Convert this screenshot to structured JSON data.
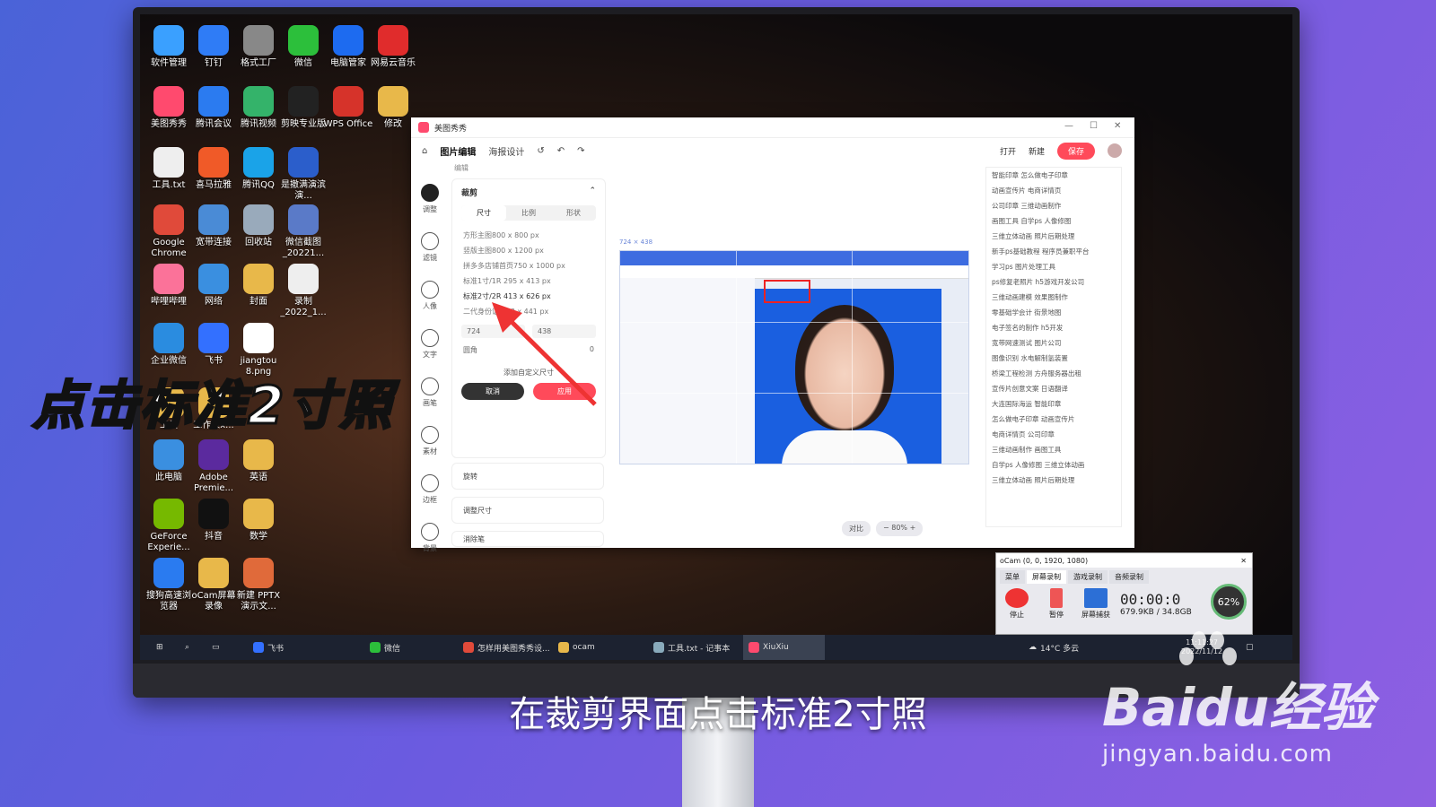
{
  "desktop_icons": [
    {
      "label": "软件管理",
      "color": "#3aa0ff"
    },
    {
      "label": "钉钉",
      "color": "#2f7cf6"
    },
    {
      "label": "格式工厂",
      "color": "#888"
    },
    {
      "label": "微信",
      "color": "#2cbf3b"
    },
    {
      "label": "电脑管家",
      "color": "#1d6bf0"
    },
    {
      "label": "网易云音乐",
      "color": "#e02c2c"
    },
    {
      "label": "美图秀秀",
      "color": "#ff4a6e"
    },
    {
      "label": "腾讯会议",
      "color": "#2b7bf0"
    },
    {
      "label": "腾讯视频",
      "color": "#34b36a"
    },
    {
      "label": "剪映专业版",
      "color": "#222"
    },
    {
      "label": "WPS Office",
      "color": "#d6332a"
    },
    {
      "label": "修改",
      "color": "#e8b84a"
    },
    {
      "label": "工具.txt",
      "color": "#eee"
    },
    {
      "label": "喜马拉雅",
      "color": "#f05a28"
    },
    {
      "label": "腾讯QQ",
      "color": "#1aa3e8"
    },
    {
      "label": "是撤满演滨演...",
      "color": "#2b5ecb"
    },
    {
      "label": "Google Chrome",
      "color": "#e04a3a"
    },
    {
      "label": "宽带连接",
      "color": "#4a8bd6"
    },
    {
      "label": "回收站",
      "color": "#9ab"
    },
    {
      "label": "微信截图_20221...",
      "color": "#5a7ac8"
    },
    {
      "label": "哔哩哔哩",
      "color": "#fb7299"
    },
    {
      "label": "网络",
      "color": "#3a8fe0"
    },
    {
      "label": "封面",
      "color": "#e8b84a"
    },
    {
      "label": "录制_2022_1...",
      "color": "#eee"
    },
    {
      "label": "企业微信",
      "color": "#2a8ce0"
    },
    {
      "label": "飞书",
      "color": "#3370ff"
    },
    {
      "label": "jiangtou 8.png",
      "color": "#fff"
    },
    {
      "label": "工具",
      "color": "#e8b84a"
    },
    {
      "label": "工作表x...",
      "color": "#e8b84a"
    },
    {
      "label": "此电脑",
      "color": "#3a8fe0"
    },
    {
      "label": "Adobe Premie...",
      "color": "#5b2a9e"
    },
    {
      "label": "英语",
      "color": "#e8b84a"
    },
    {
      "label": "GeForce Experie...",
      "color": "#76b900"
    },
    {
      "label": "抖音",
      "color": "#111"
    },
    {
      "label": "数学",
      "color": "#e8b84a"
    },
    {
      "label": "搜狗高速浏览器",
      "color": "#2a7bf0"
    },
    {
      "label": "oCam屏幕录像",
      "color": "#e8b84a"
    },
    {
      "label": "新建 PPTX 演示文...",
      "color": "#e06a3a"
    }
  ],
  "meitu": {
    "title": "美图秀秀",
    "menu": [
      "图片编辑",
      "海报设计"
    ],
    "open_label": "打开",
    "new_label": "新建",
    "save_label": "保存",
    "section_label": "编辑",
    "left_tools": [
      "调整",
      "滤镜",
      "人像",
      "文字",
      "画笔",
      "素材",
      "边框",
      "背景"
    ],
    "crop": {
      "title": "裁剪",
      "tabs": [
        "尺寸",
        "比例",
        "形状"
      ],
      "presets": [
        "方形主图800 x 800 px",
        "竖版主图800 x 1200 px",
        "拼多多店铺首页750 x 1000 px",
        "标准1寸/1R 295 x 413 px",
        "标准2寸/2R 413 x 626 px",
        "二代身份证 358 x 441 px"
      ],
      "width": "724",
      "height": "438",
      "radius_label": "圆角",
      "radius_value": "0",
      "add_custom": "添加自定义尺寸",
      "cancel": "取消",
      "apply": "应用"
    },
    "fold_rotate": "旋转",
    "fold_resize": "调整尺寸",
    "fold_more": "消除笔",
    "canvas_size": "724 × 438",
    "compare_label": "对比",
    "zoom_value": "80%",
    "right_list": [
      "智能印章  怎么做电子印章",
      "动画宣传片  电商详情页",
      "公司印章  三维动画制作",
      "画图工具  自学ps  人像修图",
      "三维立体动画  照片后期处理",
      "新手ps基础教程  程序员兼职平台",
      "学习ps  图片处理工具",
      "ps修复老照片  h5游戏开发公司",
      "三维动画建模  效果图制作",
      "零基础学会计  街景地图",
      "电子签名的制作  h5开发",
      "宽带网速测试  图片公司",
      "图像识别  水电解制氢装置",
      "桥梁工程检测  方舟服务器出租",
      "宣传片创意文案  日语翻译",
      "大连国际海运  智能印章",
      "怎么做电子印章  动画宣传片",
      "电商详情页  公司印章",
      "三维动画制作  画图工具",
      "自学ps  人像修图  三维立体动画",
      "三维立体动画  照片后期处理"
    ]
  },
  "ocam": {
    "title": "oCam (0, 0, 1920, 1080)",
    "tabs": [
      "菜单",
      "屏幕录制",
      "游戏录制",
      "音频录制"
    ],
    "stop": "停止",
    "pause": "暂停",
    "capture": "屏幕捕获",
    "timer": "00:00:0",
    "size": "679.9KB / 34.8GB",
    "cpu": "62"
  },
  "taskbar": {
    "items": [
      "飞书",
      "微信",
      "怎样用美图秀秀设...",
      "ocam",
      "工具.txt - 记事本",
      "XiuXiu"
    ],
    "weather": "14°C  多云",
    "time": "11:11:27",
    "date": "2022/11/12"
  },
  "overlay": {
    "headline": "点击标准2寸照",
    "subtitle": "在裁剪界面点击标准2寸照",
    "watermark_brand": "Baidu经验",
    "watermark_url": "jingyan.baidu.com"
  }
}
